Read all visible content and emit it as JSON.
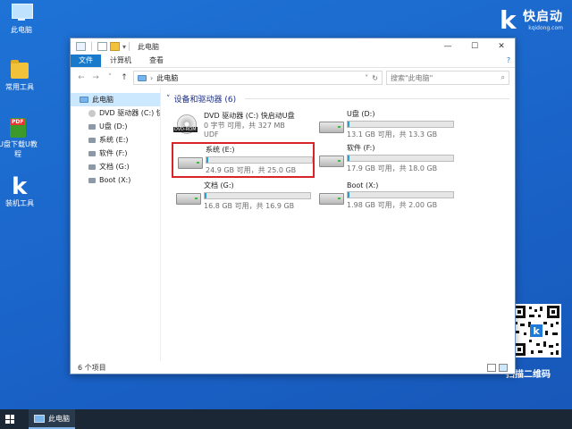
{
  "desktop": {
    "icons": [
      {
        "label": "此电脑"
      },
      {
        "label": "常用工具"
      },
      {
        "label": "U盘下载U教程"
      },
      {
        "label": "装机工具"
      }
    ],
    "logo": {
      "k": "k",
      "brand": "快启动",
      "domain": "kqidong.com"
    },
    "qr_label": "扫描二维码"
  },
  "window": {
    "title": "此电脑",
    "controls": {
      "minimize": "—",
      "maximize": "☐",
      "close": "✕"
    },
    "ribbon": {
      "file": "文件",
      "tabs": [
        "计算机",
        "查看"
      ],
      "help": "?"
    },
    "address": {
      "path": "此电脑",
      "search_placeholder": "搜索\"此电脑\""
    },
    "nav_pane": [
      {
        "label": "此电脑",
        "icon": "pc-icon",
        "selected": true
      },
      {
        "label": "DVD 驱动器 (C:) 快",
        "icon": "dvd-icon"
      },
      {
        "label": "U盘 (D:)",
        "icon": "drive-icon"
      },
      {
        "label": "系统 (E:)",
        "icon": "drive-icon"
      },
      {
        "label": "软件 (F:)",
        "icon": "drive-icon"
      },
      {
        "label": "文档 (G:)",
        "icon": "drive-icon"
      },
      {
        "label": "Boot (X:)",
        "icon": "drive-icon"
      }
    ],
    "group_header": "设备和驱动器 (6)",
    "drives": [
      {
        "name": "DVD 驱动器 (C:) 快启动U盘",
        "line1": "0 字节 可用，共 327 MB",
        "line2": "UDF",
        "type": "dvd",
        "tag": "DVD-ROM"
      },
      {
        "name": "U盘 (D:)",
        "line1": "13.1 GB 可用，共 13.3 GB",
        "type": "hdd",
        "used_fraction": 0.015
      },
      {
        "name": "系统 (E:)",
        "line1": "24.9 GB 可用，共 25.0 GB",
        "type": "hdd",
        "used_fraction": 0.004,
        "highlighted": true
      },
      {
        "name": "软件 (F:)",
        "line1": "17.9 GB 可用，共 18.0 GB",
        "type": "hdd",
        "used_fraction": 0.006
      },
      {
        "name": "文档 (G:)",
        "line1": "16.8 GB 可用，共 16.9 GB",
        "type": "hdd",
        "used_fraction": 0.006
      },
      {
        "name": "Boot (X:)",
        "line1": "1.98 GB 可用，共 2.00 GB",
        "type": "hdd",
        "used_fraction": 0.01
      }
    ],
    "status": "6 个项目"
  },
  "taskbar": {
    "item_label": "此电脑"
  },
  "colors": {
    "accent": "#1979ca",
    "highlight_border": "#d9232b",
    "desktop": "#1a63c8"
  }
}
